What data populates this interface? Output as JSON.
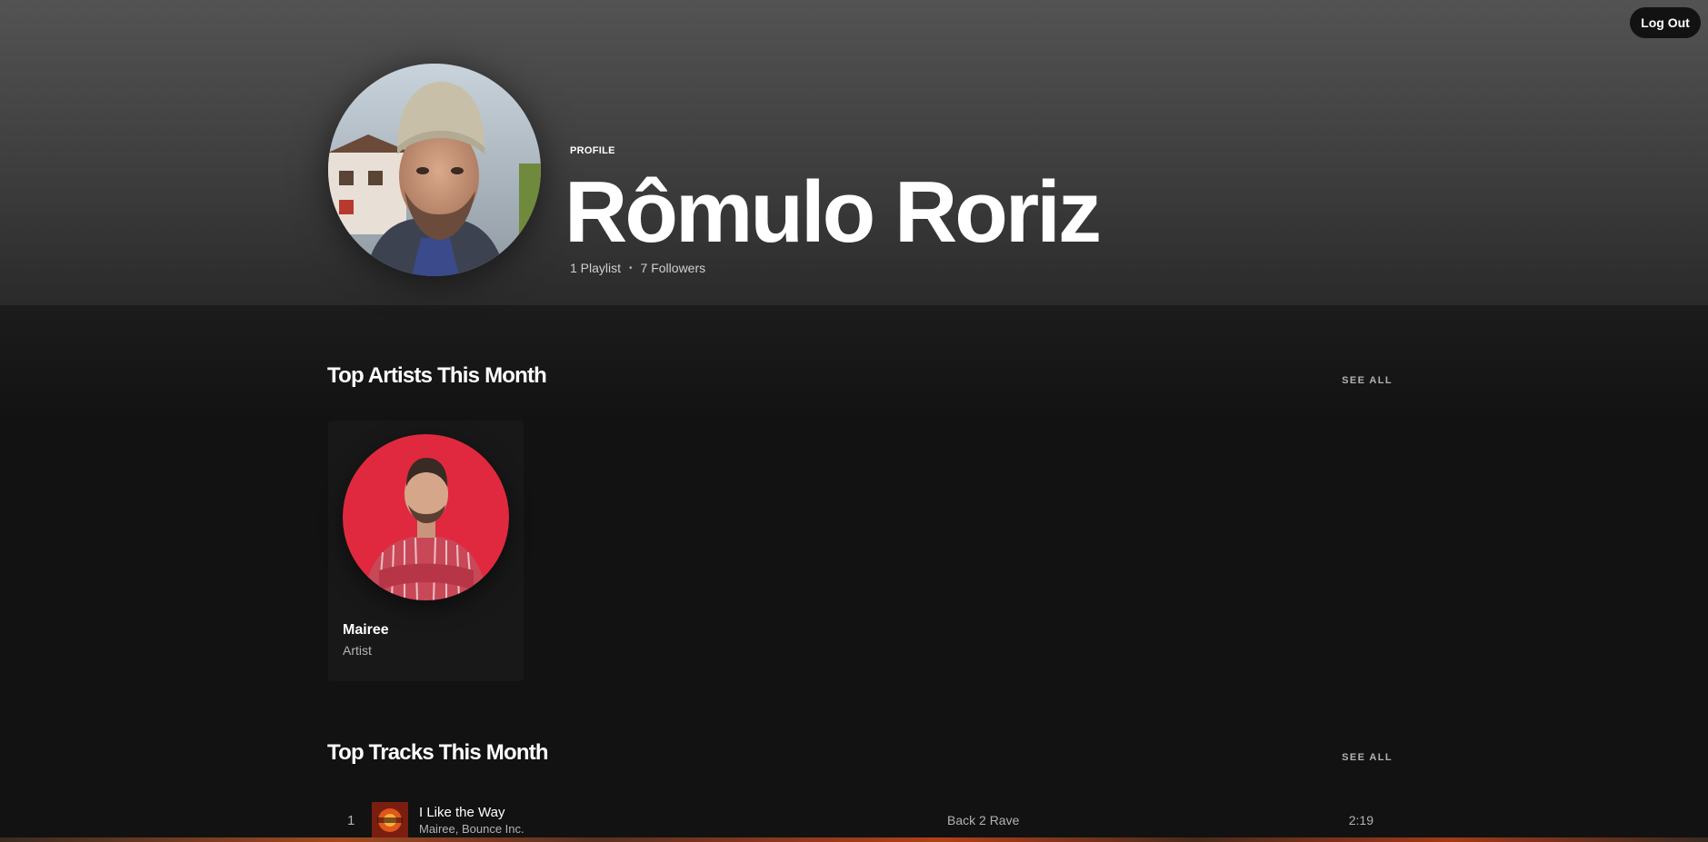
{
  "header": {
    "logout_label": "Log Out"
  },
  "profile": {
    "label": "PROFILE",
    "name": "Rômulo Roriz",
    "playlists": "1 Playlist",
    "separator": "•",
    "followers": "7 Followers"
  },
  "top_artists": {
    "title": "Top Artists This Month",
    "see_all": "SEE ALL",
    "items": [
      {
        "name": "Mairee",
        "type": "Artist"
      }
    ]
  },
  "top_tracks": {
    "title": "Top Tracks This Month",
    "see_all": "SEE ALL",
    "items": [
      {
        "rank": "1",
        "title": "I Like the Way",
        "artists": "Mairee, Bounce Inc.",
        "album": "Back 2 Rave",
        "duration": "2:19"
      }
    ]
  },
  "colors": {
    "background": "#121212",
    "card": "#181818",
    "text_secondary": "#b3b3b3"
  }
}
